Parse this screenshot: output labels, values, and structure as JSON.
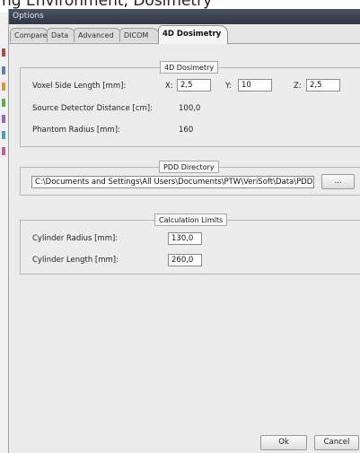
{
  "header_fragment": "ng Environment, Dosimetry",
  "window": {
    "title": "Options"
  },
  "tabs": [
    {
      "label": "Compare"
    },
    {
      "label": "Data"
    },
    {
      "label": "Advanced"
    },
    {
      "label": "DICOM"
    },
    {
      "label": "4D Dosimetry",
      "active": true
    }
  ],
  "dosimetry": {
    "legend": "4D Dosimetry",
    "voxel_label": "Voxel Side Length [mm]:",
    "x_label": "X:",
    "x_value": "2,5",
    "y_label": "Y:",
    "y_value": "10",
    "z_label": "Z:",
    "z_value": "2,5",
    "sdd_label": "Source Detector Distance [cm]:",
    "sdd_value": "100,0",
    "phantom_label": "Phantom Radius [mm]:",
    "phantom_value": "160"
  },
  "pdd": {
    "legend": "PDD Directory",
    "path": "C:\\Documents and Settings\\All Users\\Documents\\PTW\\VeriSoft\\Data\\PDDD",
    "browse_label": "..."
  },
  "limits": {
    "legend": "Calculation Limits",
    "cyl_radius_label": "Cylinder Radius [mm]:",
    "cyl_radius_value": "130,0",
    "cyl_length_label": "Cylinder Length [mm]:",
    "cyl_length_value": "260,0"
  },
  "footer": {
    "ok_label": "Ok",
    "cancel_label": "Cancel"
  }
}
